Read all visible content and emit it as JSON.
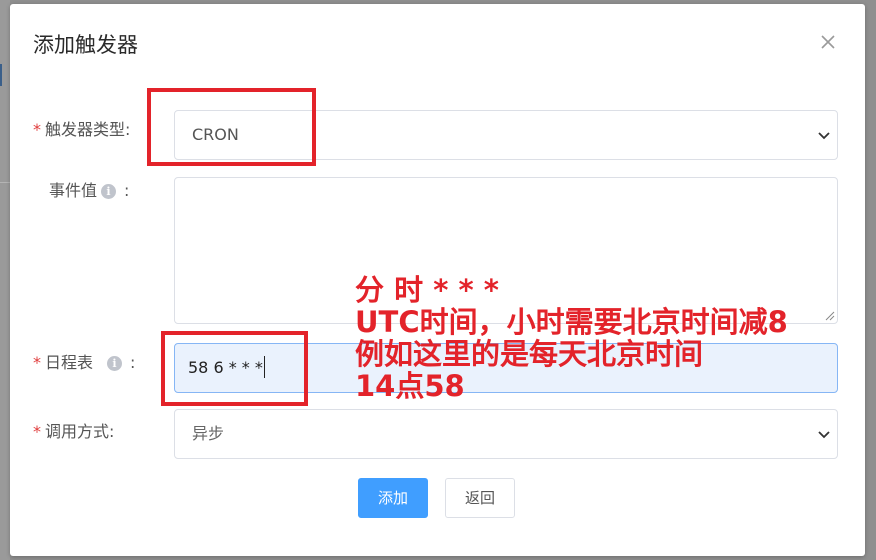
{
  "dialog": {
    "title": "添加触发器"
  },
  "form": {
    "trigger_type": {
      "required_mark": "*",
      "label": "触发器类型:",
      "value": "CRON"
    },
    "event_value": {
      "label": "事件值",
      "colon": ":",
      "value": ""
    },
    "schedule": {
      "required_mark": "*",
      "label": "日程表",
      "colon": ":",
      "value": "58 6 * * *"
    },
    "call_mode": {
      "required_mark": "*",
      "label": "调用方式:",
      "value": "异步"
    }
  },
  "buttons": {
    "add_label": "添加",
    "back_label": "返回"
  },
  "annotation": {
    "lines": [
      "分 时 * * *",
      "UTC时间，小时需要北京时间减8",
      "例如这里的是每天北京时间",
      "14点58"
    ],
    "color": "#e3232a"
  },
  "colors": {
    "primary": "#409eff",
    "required": "#e03c3c",
    "focus_border": "#86b6f5",
    "focus_bg": "#eaf2fd",
    "annotation_red": "#e3232a"
  },
  "icons": {
    "close": "close-icon",
    "dropdown": "chevron-down-icon",
    "info": "info-icon",
    "resize": "resize-handle-icon"
  }
}
